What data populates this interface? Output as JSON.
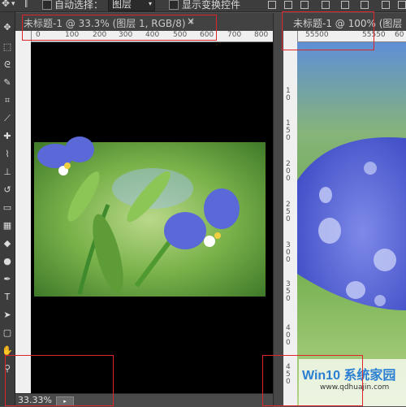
{
  "options_bar": {
    "auto_select_label": "自动选择：",
    "auto_select_value": "图层",
    "show_transform_label": "显示变换控件"
  },
  "doc1": {
    "tab_title": "未标题-1 @ 33.3% (图层 1, RGB/8) *",
    "close_glyph": "×",
    "ruler_h": [
      "0",
      "100",
      "200",
      "300",
      "400",
      "500",
      "600",
      "700",
      "800"
    ],
    "ruler_v": [],
    "zoom": "33.33%"
  },
  "doc2": {
    "tab_title": "未标题-1 @ 100% (图层",
    "ruler_h": [
      "55500",
      "55550",
      "60"
    ],
    "ruler_v": [
      "1 0",
      "1 5 0",
      "2 0 0",
      "2 5 0",
      "3 0 0",
      "3 5 0",
      "4 0 0",
      "4 5 0"
    ]
  },
  "watermark": {
    "brand": "Win10 系统家园",
    "url": "www.qdhuajin.com"
  },
  "colors": {
    "red_highlight": "#e0242b",
    "petal": "#5a68d8",
    "leaf": "#7cc043"
  }
}
